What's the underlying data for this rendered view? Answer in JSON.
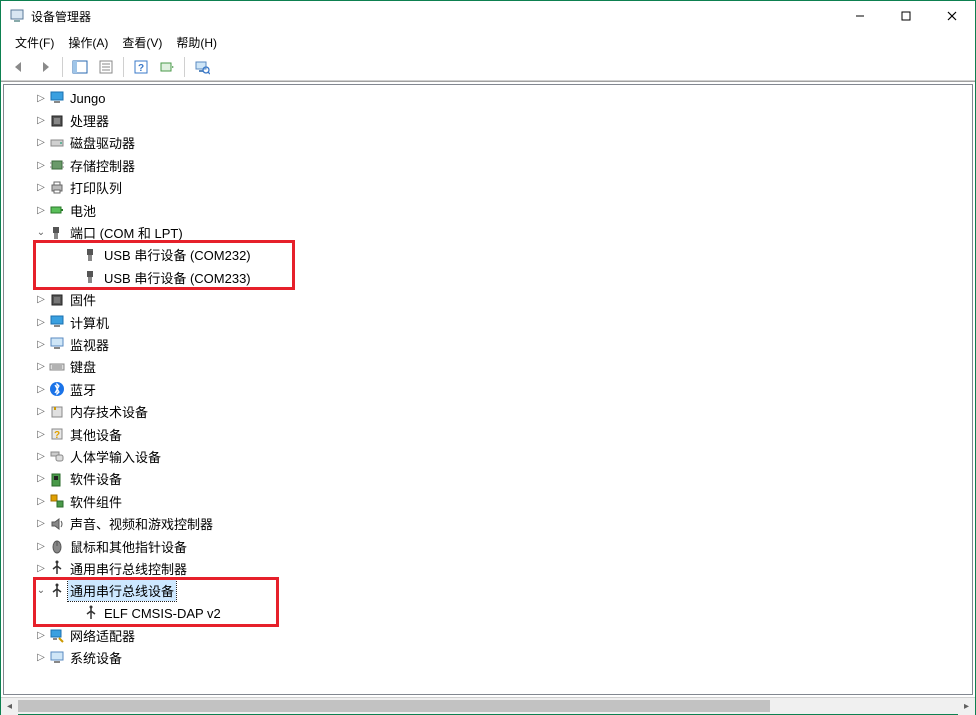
{
  "window": {
    "title": "设备管理器"
  },
  "menu": {
    "file": "文件(F)",
    "action": "操作(A)",
    "view": "查看(V)",
    "help": "帮助(H)"
  },
  "tree": {
    "jungo": "Jungo",
    "processors": "处理器",
    "disks": "磁盘驱动器",
    "storage": "存储控制器",
    "printq": "打印队列",
    "battery": "电池",
    "ports": "端口 (COM 和 LPT)",
    "com232": "USB 串行设备 (COM232)",
    "com233": "USB 串行设备 (COM233)",
    "firmware": "固件",
    "computer": "计算机",
    "monitors": "监视器",
    "keyboards": "键盘",
    "bluetooth": "蓝牙",
    "memtech": "内存技术设备",
    "other": "其他设备",
    "hid": "人体学输入设备",
    "softdev": "软件设备",
    "softcomp": "软件组件",
    "audio": "声音、视频和游戏控制器",
    "mice": "鼠标和其他指针设备",
    "usbctrl": "通用串行总线控制器",
    "usbdev": "通用串行总线设备",
    "elf": "ELF CMSIS-DAP v2",
    "netadapters": "网络适配器",
    "sysdev": "系统设备"
  },
  "colors": {
    "highlight_border": "#e6202a",
    "window_border": "#0d8050"
  }
}
